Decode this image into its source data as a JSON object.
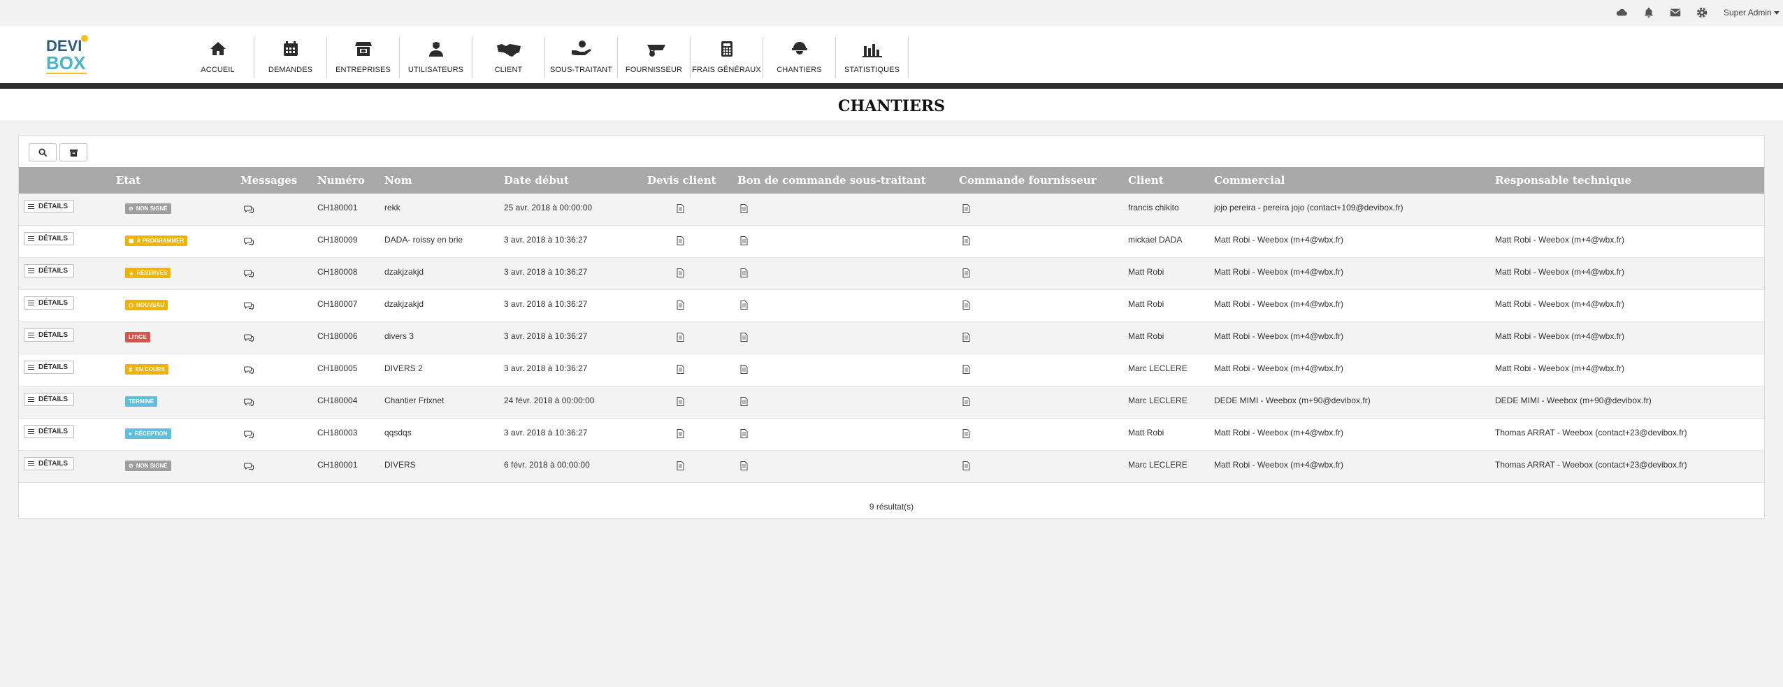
{
  "topbar": {
    "icons": [
      "cloud-icon",
      "bell-icon",
      "envelope-icon",
      "gear-icon"
    ],
    "user_label": "Super Admin"
  },
  "logo": {
    "line1": "DEVI",
    "line2": "BOX"
  },
  "nav": [
    {
      "label": "ACCUEIL",
      "icon": "home-icon"
    },
    {
      "label": "DEMANDES",
      "icon": "calendar-icon"
    },
    {
      "label": "ENTREPRISES",
      "icon": "store-icon"
    },
    {
      "label": "UTILISATEURS",
      "icon": "user-icon"
    },
    {
      "label": "CLIENT",
      "icon": "handshake-icon"
    },
    {
      "label": "SOUS-TRAITANT",
      "icon": "hand-money-icon"
    },
    {
      "label": "FOURNISSEUR",
      "icon": "wheelbarrow-icon"
    },
    {
      "label": "FRAIS GÉNÉRAUX",
      "icon": "calculator-icon"
    },
    {
      "label": "CHANTIERS",
      "icon": "hard-hat-icon"
    },
    {
      "label": "STATISTIQUES",
      "icon": "bar-chart-icon"
    }
  ],
  "page_title": "CHANTIERS",
  "toolbar": {
    "icons": [
      "search-icon",
      "archive-icon"
    ]
  },
  "table": {
    "headers": {
      "etat": "Etat",
      "messages": "Messages",
      "numero": "Numéro",
      "nom": "Nom",
      "date_debut": "Date début",
      "devis_client": "Devis client",
      "bon_commande": "Bon de commande sous-traitant",
      "commande_fournisseur": "Commande fournisseur",
      "client": "Client",
      "commercial": "Commercial",
      "responsable": "Responsable technique"
    },
    "details_label": "DÉTAILS",
    "rows": [
      {
        "etat": "NON SIGNÉ",
        "numero": "CH180001",
        "nom": "rekk",
        "date": "25 avr. 2018 à 00:00:00",
        "client": "francis chikito",
        "commercial": "jojo pereira - pereira jojo (contact+109@devibox.fr)",
        "responsable": ""
      },
      {
        "etat": "À PROGRAMMER",
        "numero": "CH180009",
        "nom": "DADA- roissy en brie",
        "date": "3 avr. 2018 à 10:36:27",
        "client": "mickael DADA",
        "commercial": "Matt Robi - Weebox (m+4@wbx.fr)",
        "responsable": "Matt Robi - Weebox (m+4@wbx.fr)"
      },
      {
        "etat": "RÉSERVES",
        "numero": "CH180008",
        "nom": "dzakjzakjd",
        "date": "3 avr. 2018 à 10:36:27",
        "client": "Matt Robi",
        "commercial": "Matt Robi - Weebox (m+4@wbx.fr)",
        "responsable": "Matt Robi - Weebox (m+4@wbx.fr)"
      },
      {
        "etat": "NOUVEAU",
        "numero": "CH180007",
        "nom": "dzakjzakjd",
        "date": "3 avr. 2018 à 10:36:27",
        "client": "Matt Robi",
        "commercial": "Matt Robi - Weebox (m+4@wbx.fr)",
        "responsable": "Matt Robi - Weebox (m+4@wbx.fr)"
      },
      {
        "etat": "LITIGE",
        "numero": "CH180006",
        "nom": "divers 3",
        "date": "3 avr. 2018 à 10:36:27",
        "client": "Matt Robi",
        "commercial": "Matt Robi - Weebox (m+4@wbx.fr)",
        "responsable": "Matt Robi - Weebox (m+4@wbx.fr)"
      },
      {
        "etat": "EN COURS",
        "numero": "CH180005",
        "nom": "DIVERS 2",
        "date": "3 avr. 2018 à 10:36:27",
        "client": "Marc LECLERE",
        "commercial": "Matt Robi - Weebox (m+4@wbx.fr)",
        "responsable": "Matt Robi - Weebox (m+4@wbx.fr)"
      },
      {
        "etat": "TERMINÉ",
        "numero": "CH180004",
        "nom": "Chantier Frixnet",
        "date": "24 févr. 2018 à 00:00:00",
        "client": "Marc LECLERE",
        "commercial": "DEDE MIMI - Weebox (m+90@devibox.fr)",
        "responsable": "DEDE MIMI - Weebox (m+90@devibox.fr)"
      },
      {
        "etat": "RÉCEPTION",
        "numero": "CH180003",
        "nom": "qqsdqs",
        "date": "3 avr. 2018 à 10:36:27",
        "client": "Matt Robi",
        "commercial": "Matt Robi - Weebox (m+4@wbx.fr)",
        "responsable": "Thomas ARRAT - Weebox (contact+23@devibox.fr)"
      },
      {
        "etat": "NON SIGNÉ",
        "numero": "CH180001",
        "nom": "DIVERS",
        "date": "6 févr. 2018 à 00:00:00",
        "client": "Marc LECLERE",
        "commercial": "Matt Robi - Weebox (m+4@wbx.fr)",
        "responsable": "Thomas ARRAT - Weebox (contact+23@devibox.fr)"
      }
    ],
    "status_colors": {
      "NON SIGNÉ": "#9e9e9e",
      "À PROGRAMMER": "#f0b400",
      "RÉSERVES": "#f0b400",
      "NOUVEAU": "#f0b400",
      "LITIGE": "#d9534f",
      "EN COURS": "#f0b400",
      "TERMINÉ": "#5bc0de",
      "RÉCEPTION": "#5bc0de"
    },
    "status_icons": {
      "NON SIGNÉ": "ban-icon",
      "À PROGRAMMER": "calendar-icon",
      "RÉSERVES": "warning-icon",
      "NOUVEAU": "clock-icon",
      "LITIGE": "",
      "EN COURS": "hourglass-icon",
      "TERMINÉ": "",
      "RÉCEPTION": "circle-icon"
    }
  },
  "footer": {
    "result_count": "9 résultat(s)"
  }
}
